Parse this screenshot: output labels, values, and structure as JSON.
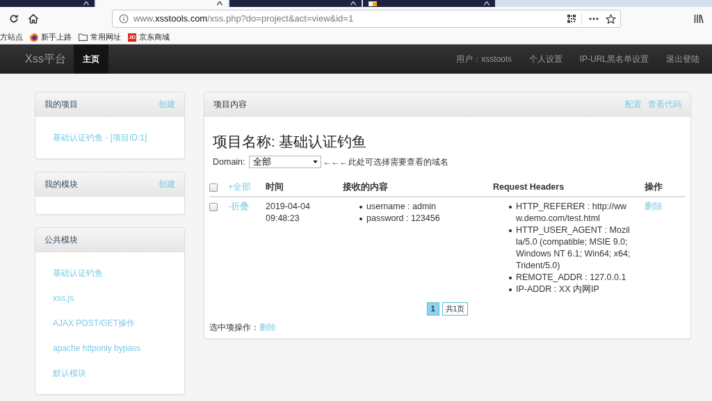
{
  "browser": {
    "tabs": [
      {
        "selected": false,
        "favicon": false
      },
      {
        "selected": true,
        "favicon": false
      },
      {
        "selected": false,
        "favicon": false
      },
      {
        "selected": false,
        "favicon": true
      }
    ],
    "address_bar": {
      "url": [
        {
          "text": "www.",
          "strong": false
        },
        {
          "text": "xsstools.com",
          "strong": true
        },
        {
          "text": "/xss.php?do=project&act=view&id=1",
          "strong": false
        }
      ]
    },
    "bookmarks": [
      {
        "label": "方站点",
        "kind": "plain"
      },
      {
        "label": "新手上路",
        "kind": "browser"
      },
      {
        "label": "常用网址",
        "kind": "folder"
      },
      {
        "label": "京东商城",
        "kind": "logo",
        "logo": "JD"
      }
    ]
  },
  "navbar": {
    "brand": "Xss平台",
    "items": [
      {
        "label": "主页",
        "selected": true
      }
    ],
    "links": [
      "用户：xsstools",
      "个人设置",
      "IP-URL黑名单设置",
      "退出登陆"
    ]
  },
  "sidebar": {
    "panels": [
      {
        "title": "我的项目",
        "action": "创建",
        "items": [
          "基础认证钓鱼 - [项目ID:1]"
        ]
      },
      {
        "title": "我的模块",
        "action": "创建"
      },
      {
        "title": "公共模块",
        "items": [
          "基础认证钓鱼",
          "xss.js",
          "AJAX POST/GET操作",
          "apache httponly bypass",
          "默认模块"
        ]
      }
    ]
  },
  "project": {
    "title": "项目内容",
    "actions": [
      "配置",
      "查看代码"
    ],
    "heading": "项目名称: 基础认证钓鱼",
    "domain": {
      "label": "Domain:",
      "value": "全部",
      "hint": "←←←此处可选择需要查看的域名"
    },
    "table": {
      "select_all": {
        "checked": false
      },
      "columns": [
        {
          "label": "+全部",
          "kind": "link"
        },
        {
          "label": "时间",
          "kind": "heading"
        },
        {
          "label": "接收的内容",
          "kind": "heading"
        },
        {
          "label": "Request Headers",
          "kind": "heading"
        },
        {
          "label": "操作",
          "kind": "heading"
        }
      ],
      "rows": [
        {
          "checked": false,
          "toggle": "-折叠",
          "time": "2019-04-04 09:48:23",
          "content": [
            "username : admin",
            "password : 123456"
          ],
          "headers": [
            "HTTP_REFERER : http://www.demo.com/test.html",
            "HTTP_USER_AGENT : Mozilla/5.0 (compatible; MSIE 9.0; Windows NT 6.1; Win64; x64; Trident/5.0)",
            "REMOTE_ADDR : 127.0.0.1",
            "IP-ADDR : XX 内网IP"
          ],
          "action": "删除"
        }
      ]
    },
    "pagination": [
      {
        "label": "1",
        "selected": true
      },
      {
        "label": "共1页",
        "selected": false
      }
    ],
    "bulk": {
      "label": "选中项操作：",
      "action": "删除"
    }
  }
}
